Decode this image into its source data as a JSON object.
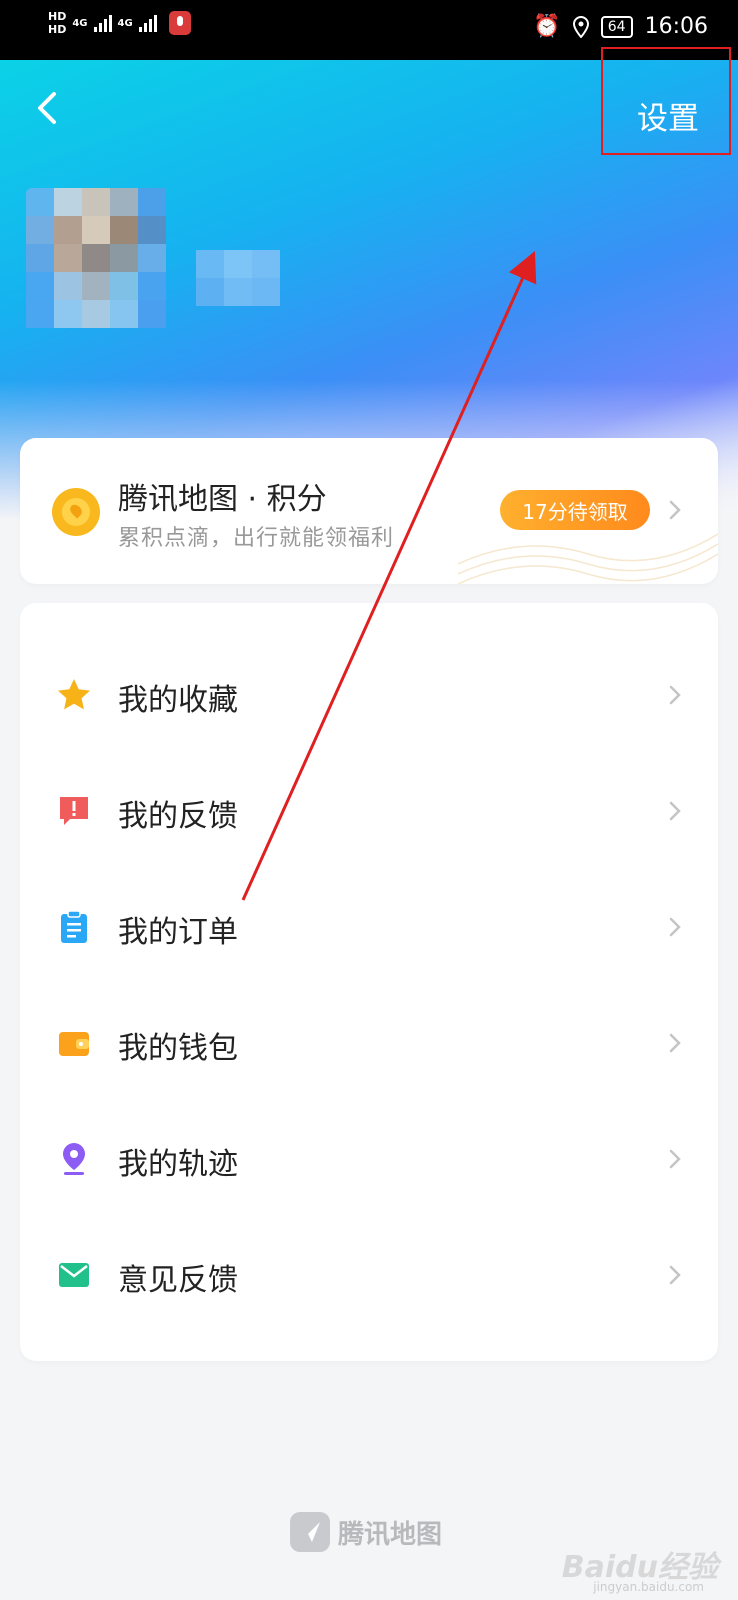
{
  "status_bar": {
    "hd1": "HD",
    "hd2": "HD",
    "net1": "4G",
    "net2": "4G",
    "battery": "64",
    "time": "16:06"
  },
  "header": {
    "settings_label": "设置"
  },
  "points": {
    "title": "腾讯地图 · 积分",
    "subtitle": "累积点滴，出行就能领福利",
    "badge": "17分待领取"
  },
  "menu": [
    {
      "label": "我的收藏",
      "icon": "star-icon",
      "color": "#f7b217"
    },
    {
      "label": "我的反馈",
      "icon": "feedback-icon",
      "color": "#f05b5b"
    },
    {
      "label": "我的订单",
      "icon": "clipboard-icon",
      "color": "#2ba8f5"
    },
    {
      "label": "我的钱包",
      "icon": "wallet-icon",
      "color": "#fba21a"
    },
    {
      "label": "我的轨迹",
      "icon": "location-pin-icon",
      "color": "#8c5cf3"
    },
    {
      "label": "意见反馈",
      "icon": "mail-icon",
      "color": "#22c08a"
    }
  ],
  "footer": {
    "app_name": "腾讯地图"
  },
  "watermark": {
    "brand": "Baidu经验",
    "url": "jingyan.baidu.com"
  },
  "colors": {
    "accent_orange": "#ff9a24",
    "hero_cyan": "#0bd2e6",
    "hero_blue": "#3b8ff6",
    "annotation_red": "#e02020"
  }
}
